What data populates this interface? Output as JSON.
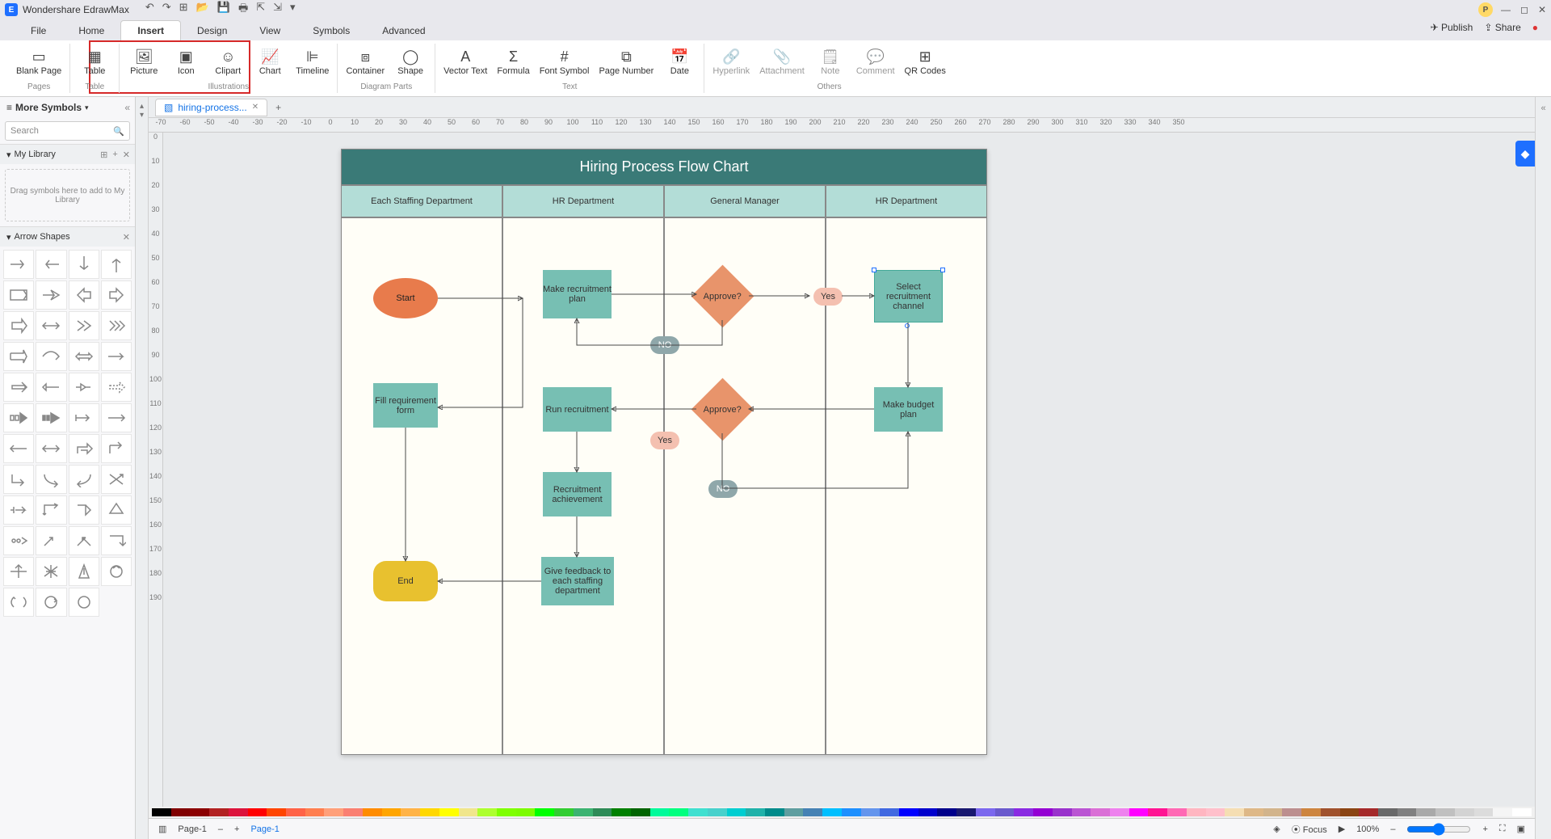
{
  "app_title": "Wondershare EdrawMax",
  "menu": {
    "file": "File",
    "home": "Home",
    "insert": "Insert",
    "design": "Design",
    "view": "View",
    "symbols": "Symbols",
    "advanced": "Advanced"
  },
  "topright": {
    "publish": "Publish",
    "share": "Share"
  },
  "user_initial": "P",
  "ribbon": {
    "pages_group": "Pages",
    "blank_page": "Blank\nPage",
    "table_group": "Table",
    "table": "Table",
    "illus_group": "Illustrations",
    "picture": "Picture",
    "icon": "Icon",
    "clipart": "Clipart",
    "chart": "Chart",
    "timeline": "Timeline",
    "diagparts_group": "Diagram Parts",
    "container": "Container",
    "shape": "Shape",
    "text_group": "Text",
    "vectortext": "Vector\nText",
    "formula": "Formula",
    "fontsymbol": "Font\nSymbol",
    "pagenumber": "Page\nNumber",
    "date": "Date",
    "others_group": "Others",
    "hyperlink": "Hyperlink",
    "attachment": "Attachment",
    "note": "Note",
    "comment": "Comment",
    "qrcodes": "QR\nCodes"
  },
  "left": {
    "more_symbols": "More Symbols",
    "search_placeholder": "Search",
    "my_library": "My Library",
    "drag_hint": "Drag symbols here to add to My Library",
    "arrow_shapes": "Arrow Shapes"
  },
  "doc_tab": "hiring-process...",
  "canvas": {
    "title": "Hiring Process Flow Chart",
    "lanes": [
      "Each Staffing Department",
      "HR Department",
      "General Manager",
      "HR Department"
    ],
    "start": "Start",
    "fill_req": "Fill requirement form",
    "end": "End",
    "make_plan": "Make recruitment plan",
    "run_rec": "Run recruitment",
    "rec_ach": "Recruitment achievement",
    "feedback": "Give feedback to each staffing department",
    "approve": "Approve?",
    "yes": "Yes",
    "no": "NO",
    "select_channel": "Select recruitment channel",
    "budget": "Make budget plan"
  },
  "status": {
    "page": "Page-1",
    "pagebtn": "Page-1",
    "focus": "Focus",
    "zoom": "100%"
  }
}
